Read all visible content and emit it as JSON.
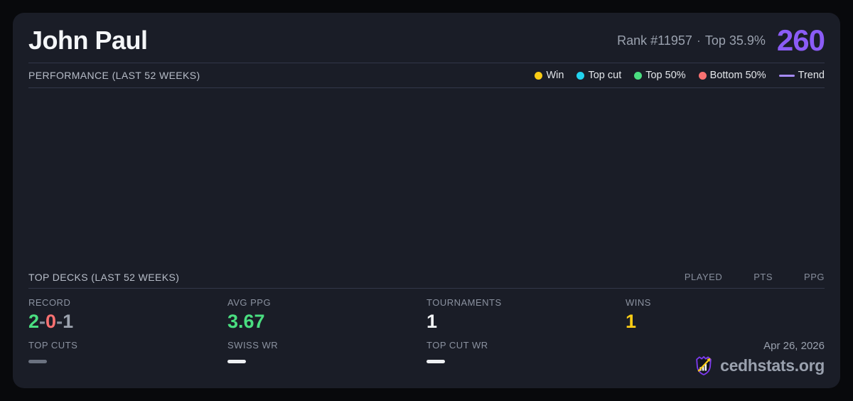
{
  "header": {
    "title": "John Paul",
    "rank_text": "Rank #11957",
    "separator": "·",
    "top_percent": "Top 35.9%",
    "points": "260",
    "points_color": "#8b5cf6"
  },
  "performance": {
    "label": "PERFORMANCE (LAST 52 WEEKS)",
    "legend": {
      "items": [
        {
          "label": "Win",
          "color": "#facc15"
        },
        {
          "label": "Top cut",
          "color": "#22d3ee"
        },
        {
          "label": "Top 50%",
          "color": "#4ade80"
        },
        {
          "label": "Bottom 50%",
          "color": "#f87171"
        }
      ],
      "trend": {
        "label": "Trend",
        "color": "#a78bfa"
      }
    },
    "chart": {
      "type": "scatter",
      "points": [],
      "note_visible": false
    }
  },
  "top_decks": {
    "label": "TOP DECKS (LAST 52 WEEKS)",
    "columns": [
      "PLAYED",
      "PTS",
      "PPG"
    ],
    "rows": []
  },
  "stats": {
    "record": {
      "label": "RECORD",
      "wins": "2",
      "losses": "0",
      "draws": "1",
      "separator": "-"
    },
    "avg_ppg": {
      "label": "AVG PPG",
      "value": "3.67",
      "color": "#4ade80"
    },
    "tournaments": {
      "label": "TOURNAMENTS",
      "value": "1"
    },
    "wins": {
      "label": "WINS",
      "value": "1",
      "color": "#facc15"
    },
    "top_cuts": {
      "label": "TOP CUTS",
      "value": "—"
    },
    "swiss_wr": {
      "label": "SWISS WR",
      "value": "—"
    },
    "top_cut_wr": {
      "label": "TOP CUT WR",
      "value": "—"
    }
  },
  "footer": {
    "date": "Apr 26, 2026",
    "brand": "cedhstats.org"
  }
}
